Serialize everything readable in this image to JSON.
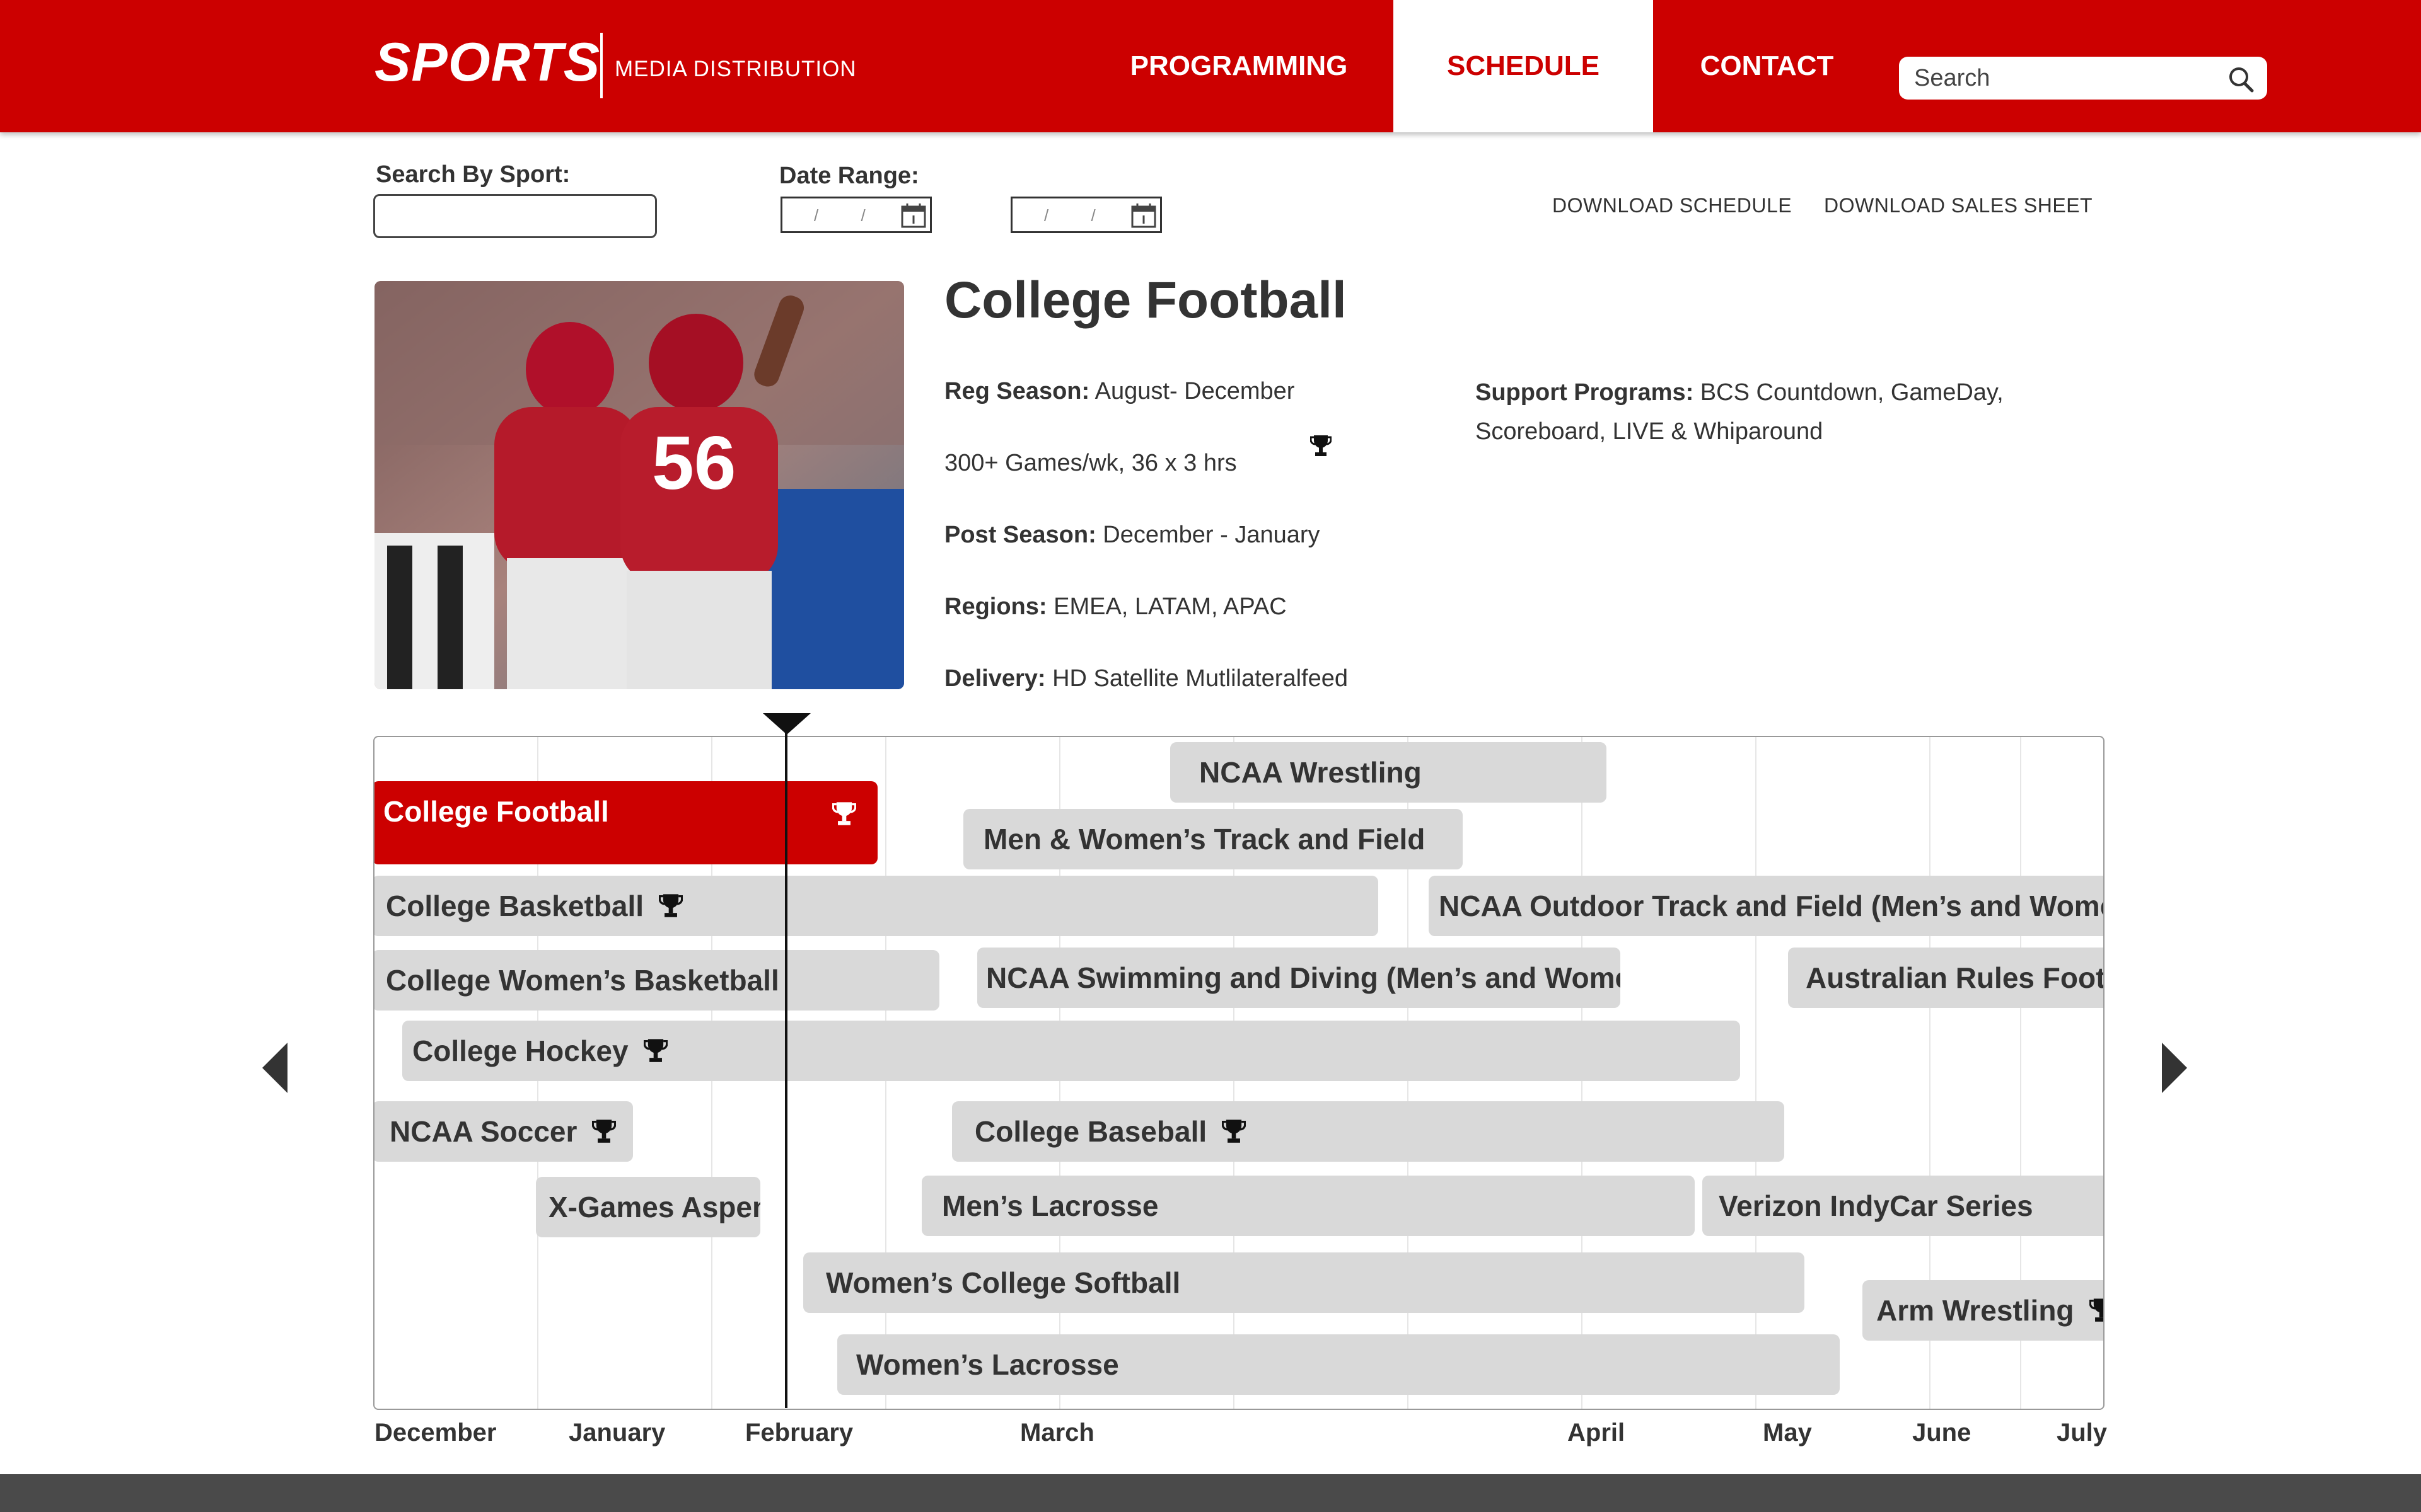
{
  "header": {
    "logo": "SPORTS",
    "logo_sub": "MEDIA DISTRIBUTION",
    "nav": [
      "PROGRAMMING",
      "SCHEDULE",
      "CONTACT"
    ],
    "active_nav": "SCHEDULE",
    "search_placeholder": "Search"
  },
  "filters": {
    "sport_label": "Search By Sport:",
    "date_label": "Date Range:",
    "date_placeholder": "/ /",
    "download_schedule": "DOWNLOAD SCHEDULE",
    "download_sales": "DOWNLOAD SALES SHEET"
  },
  "detail": {
    "title": "College Football",
    "reg_season_label": "Reg Season:",
    "reg_season_value": " August- December",
    "games": "300+ Games/wk, 36 x 3 hrs",
    "post_season_label": "Post Season:",
    "post_season_value": " December - January",
    "regions_label": "Regions:",
    "regions_value": " EMEA, LATAM, APAC",
    "delivery_label": "Delivery:",
    "delivery_value": " HD Satellite Mutlilateralfeed",
    "support_label": "Support Programs:",
    "support_value": " BCS Countdown, GameDay, Scoreboard, LIVE & Whiparound"
  },
  "timeline": {
    "months": [
      "December",
      "January",
      "February",
      "March",
      "April",
      "May",
      "June",
      "July"
    ],
    "bars": [
      {
        "label": "NCAA Wrestling",
        "trophy": false,
        "active": false
      },
      {
        "label": "College Football",
        "trophy": true,
        "active": true
      },
      {
        "label": "Men & Women’s Track and Field",
        "trophy": false,
        "active": false
      },
      {
        "label": "College Basketball",
        "trophy": true,
        "active": false
      },
      {
        "label": "NCAA Outdoor Track and Field (Men’s and Women’s)",
        "trophy": false,
        "active": false
      },
      {
        "label": "College Women’s Basketball",
        "trophy": false,
        "active": false
      },
      {
        "label": "NCAA Swimming and Diving (Men’s and Women’s)",
        "trophy": false,
        "active": false
      },
      {
        "label": "Australian Rules Football",
        "trophy": false,
        "active": false
      },
      {
        "label": "College Hockey",
        "trophy": true,
        "active": false
      },
      {
        "label": "NCAA Soccer",
        "trophy": true,
        "active": false
      },
      {
        "label": "College Baseball",
        "trophy": true,
        "active": false
      },
      {
        "label": "X-Games Aspen",
        "trophy": false,
        "active": false
      },
      {
        "label": "Men’s Lacrosse",
        "trophy": false,
        "active": false
      },
      {
        "label": "Verizon IndyCar Series",
        "trophy": false,
        "active": false
      },
      {
        "label": "Women’s College Softball",
        "trophy": false,
        "active": false
      },
      {
        "label": "Arm Wrestling",
        "trophy": true,
        "active": false
      },
      {
        "label": "Women’s Lacrosse",
        "trophy": false,
        "active": false
      }
    ]
  },
  "colors": {
    "brand_red": "#cc0000",
    "bar_gray": "#d9d9d9",
    "footer": "#4a4a4a"
  }
}
